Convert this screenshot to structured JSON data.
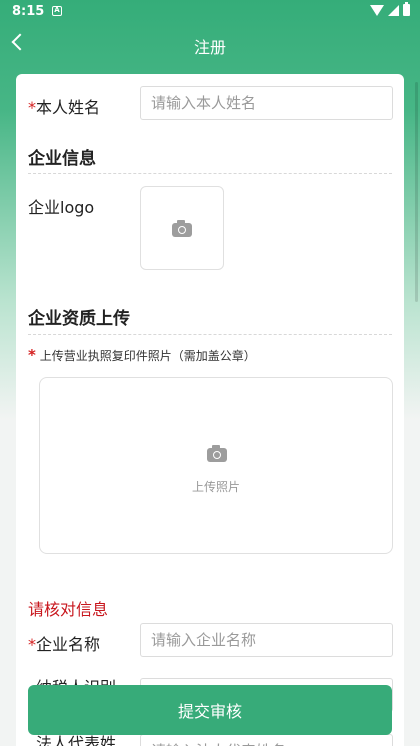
{
  "status_bar": {
    "time": "8:15",
    "notification_badge": "A"
  },
  "header": {
    "title": "注册",
    "back_icon": "chevron-left-icon"
  },
  "form": {
    "name_field": {
      "label": "本人姓名",
      "required_mark": "*",
      "placeholder": "请输入本人姓名",
      "value": ""
    },
    "company_info": {
      "title": "企业信息",
      "logo_label": "企业logo",
      "logo_icon": "camera-icon"
    },
    "qualification": {
      "title": "企业资质上传",
      "required_mark": "*",
      "hint": "上传营业执照复印件照片（需加盖公章）",
      "upload_label": "上传照片",
      "upload_icon": "camera-icon"
    },
    "verify": {
      "title": "请核对信息",
      "company_name": {
        "label": "企业名称",
        "required_mark": "*",
        "placeholder": "请输入企业名称",
        "value": ""
      },
      "taxpayer_id": {
        "label": "纳税人识别",
        "placeholder": "",
        "value": ""
      },
      "legal_rep": {
        "label": "法人代表姓",
        "placeholder": "请输入法人代表姓名",
        "value": ""
      }
    }
  },
  "submit_button": {
    "label": "提交审核"
  },
  "colors": {
    "brand_green": "#37ab79",
    "required_red": "#d42020",
    "verify_red": "#c8161d"
  }
}
